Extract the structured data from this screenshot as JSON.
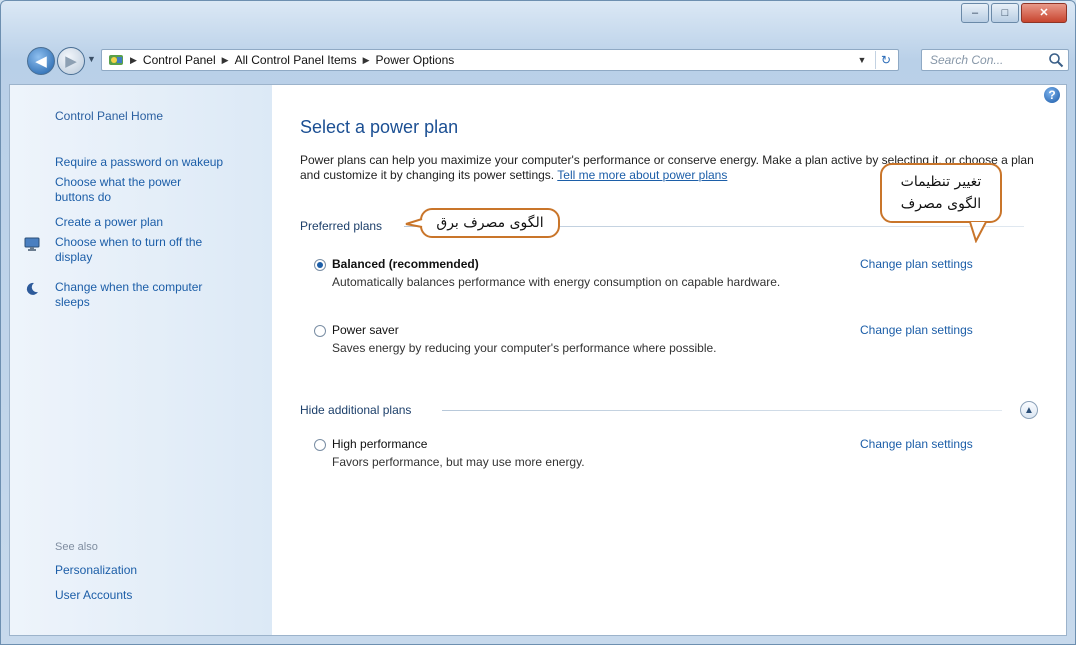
{
  "window": {
    "controls": {
      "minimize": "–",
      "maximize": "□",
      "close": "✕"
    }
  },
  "navbar": {
    "breadcrumb": [
      "Control Panel",
      "All Control Panel Items",
      "Power Options"
    ],
    "search_placeholder": "Search Con..."
  },
  "sidebar": {
    "home": "Control Panel Home",
    "links": [
      {
        "label": "Require a password on wakeup",
        "icon": "none"
      },
      {
        "label": "Choose what the power buttons do",
        "icon": "none"
      },
      {
        "label": "Create a power plan",
        "icon": "none"
      },
      {
        "label": "Choose when to turn off the display",
        "icon": "monitor-icon"
      },
      {
        "label": "Change when the computer sleeps",
        "icon": "moon-icon"
      }
    ],
    "see_also": "See also",
    "bottom_links": [
      "Personalization",
      "User Accounts"
    ]
  },
  "main": {
    "title": "Select a power plan",
    "description": "Power plans can help you maximize your computer's performance or conserve energy. Make a plan active by selecting it, or choose a plan and customize it by changing its power settings.",
    "tell_more": "Tell me more about power plans",
    "preferred_label": "Preferred plans",
    "additional_label": "Hide additional plans",
    "plans": [
      {
        "name": "Balanced (recommended)",
        "desc": "Automatically balances performance with energy consumption on capable hardware.",
        "link": "Change plan settings",
        "selected": true
      },
      {
        "name": "Power saver",
        "desc": "Saves energy by reducing your computer's performance where possible.",
        "link": "Change plan settings",
        "selected": false
      },
      {
        "name": "High performance",
        "desc": "Favors performance, but may use more energy.",
        "link": "Change plan settings",
        "selected": false
      }
    ]
  },
  "annotations": {
    "plan_callout": "الگوی مصرف برق",
    "settings_callout_line1": "تغییر تنظیمات",
    "settings_callout_line2": "الگوی مصرف"
  }
}
